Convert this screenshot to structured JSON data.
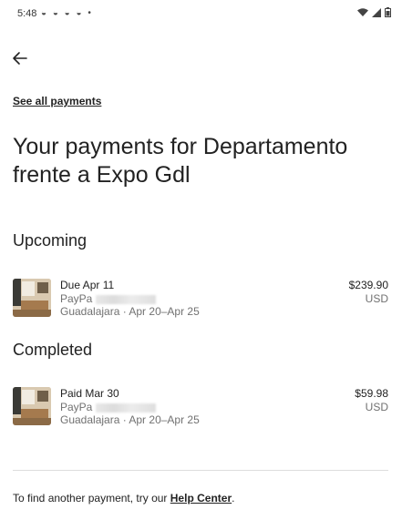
{
  "status_bar": {
    "time": "5:48",
    "notification_icons": [
      "app-notification-icon",
      "app-notification-icon",
      "app-notification-icon",
      "app-notification-icon",
      "dot-icon"
    ],
    "right_icons": [
      "wifi-icon",
      "signal-icon",
      "battery-icon"
    ]
  },
  "header": {
    "back_icon": "arrow-left-icon",
    "see_all_label": "See all payments",
    "title": "Your payments for Departamento frente a Expo Gdl"
  },
  "sections": {
    "upcoming": {
      "heading": "Upcoming",
      "payment": {
        "status": "Due Apr 11",
        "method": "PayPa",
        "location": "Guadalajara · Apr 20–Apr 25",
        "amount": "$239.90",
        "currency": "USD"
      }
    },
    "completed": {
      "heading": "Completed",
      "payment": {
        "status": "Paid Mar 30",
        "method": "PayPa",
        "location": "Guadalajara · Apr 20–Apr 25",
        "amount": "$59.98",
        "currency": "USD"
      }
    }
  },
  "footer": {
    "prefix": "To find another payment, try our ",
    "link_label": "Help Center",
    "suffix": "."
  },
  "colors": {
    "primary_text": "#222222",
    "secondary_text": "#717171",
    "divider": "#dddddd",
    "background": "#ffffff"
  }
}
